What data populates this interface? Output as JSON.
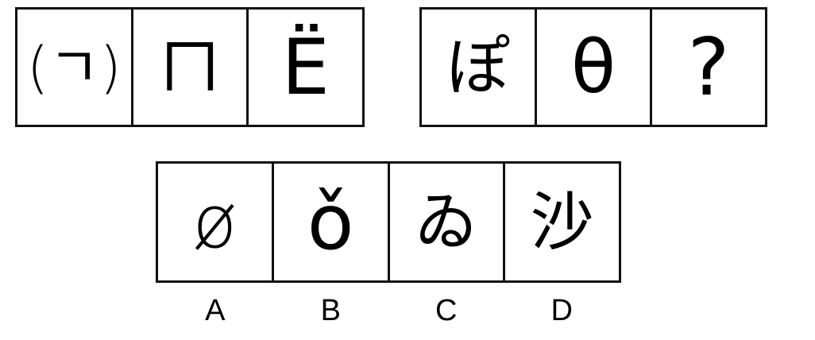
{
  "question_row": {
    "left_group": [
      "(ㄱ)",
      "ㄇ",
      "Ë"
    ],
    "right_group": [
      "ぽ",
      "θ",
      "?"
    ]
  },
  "options": [
    {
      "label": "A",
      "symbol": "ø"
    },
    {
      "label": "B",
      "symbol": "ǒ"
    },
    {
      "label": "C",
      "symbol": "ゐ"
    },
    {
      "label": "D",
      "symbol": "沙"
    }
  ],
  "colors": {
    "border": "#111111",
    "background": "#ffffff",
    "text": "#000000"
  }
}
